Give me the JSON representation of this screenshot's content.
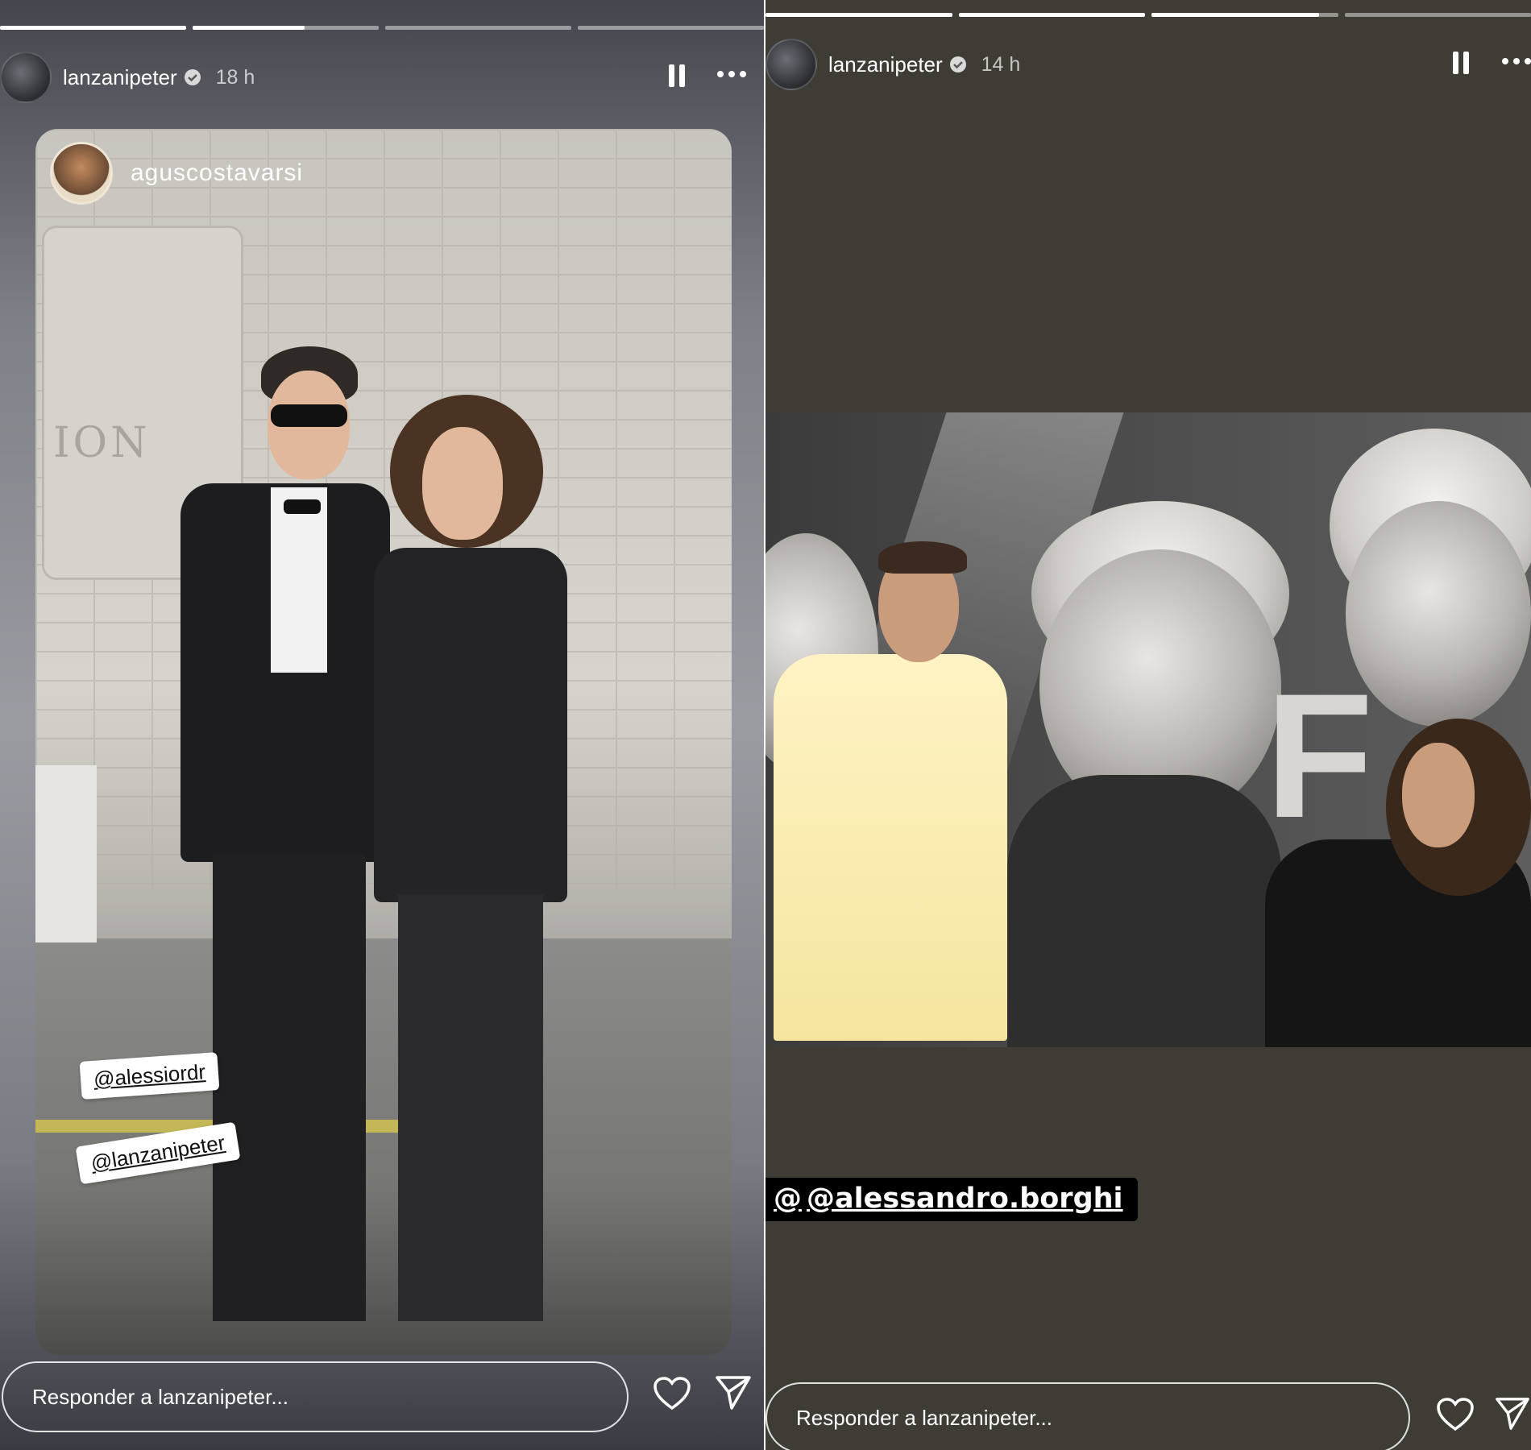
{
  "left_story": {
    "progress": {
      "segments": 4,
      "completed": 1,
      "current_fraction": 0.6
    },
    "username": "lanzanipeter",
    "time": "18 h",
    "reshared_from": "aguscostavarsi",
    "plaque_text": "ION",
    "mentions": [
      "@alessiordr",
      "@lanzanipeter"
    ],
    "reply_placeholder": "Responder a lanzanipeter..."
  },
  "right_story": {
    "progress": {
      "segments": 4,
      "completed": 2,
      "current_fraction": 0.9
    },
    "username": "lanzanipeter",
    "time": "14 h",
    "mention_tag": "@alessandro.borghi",
    "threads_glyph": "@",
    "poster_letter": "F",
    "reply_placeholder": "Responder a lanzanipeter..."
  },
  "icons": {
    "pause": "pause-icon",
    "more": "more-icon",
    "verified": "verified-badge-icon",
    "heart": "heart-icon",
    "send": "send-icon"
  },
  "colors": {
    "verified": "#3897f0",
    "right_background": "#3f3c36",
    "tag_background": "#000000"
  }
}
